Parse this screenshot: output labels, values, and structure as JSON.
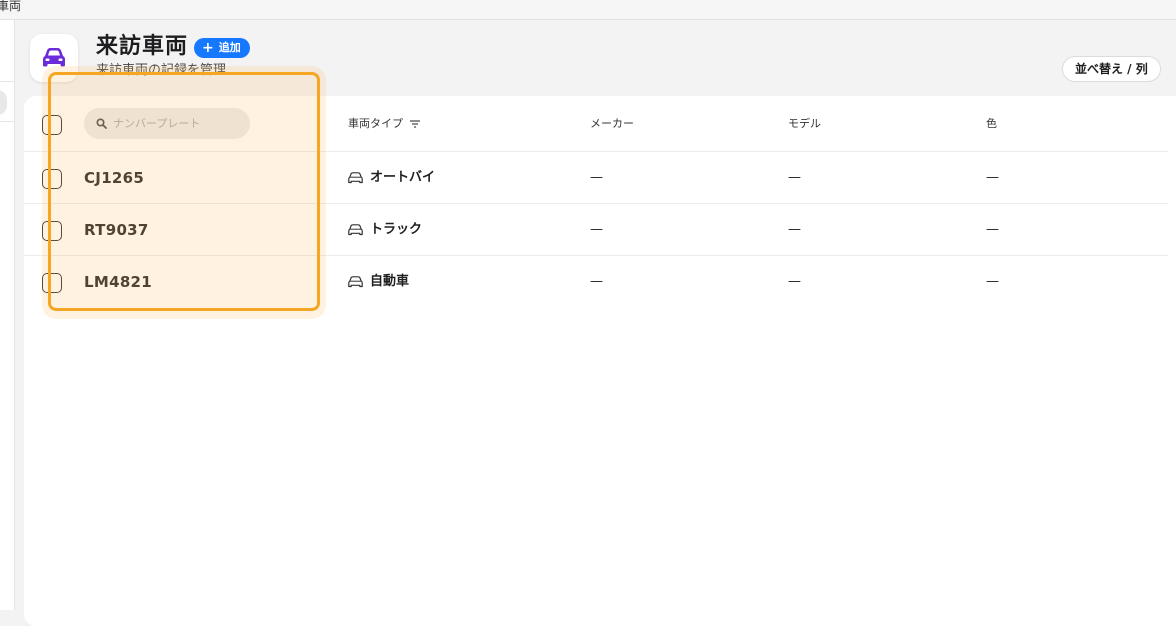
{
  "window": {
    "title": "車両"
  },
  "header": {
    "title": "来訪車両",
    "add_label": "追加",
    "subtitle": "来訪車両の記録を管理",
    "sort_label": "並べ替え / 列"
  },
  "table": {
    "search_placeholder": "ナンバープレート",
    "columns": {
      "type": "車両タイプ",
      "maker": "メーカー",
      "model": "モデル",
      "color": "色"
    },
    "rows": [
      {
        "plate": "CJ1265",
        "type": "オートバイ",
        "maker": "—",
        "model": "—",
        "color": "—"
      },
      {
        "plate": "RT9037",
        "type": "トラック",
        "maker": "—",
        "model": "—",
        "color": "—"
      },
      {
        "plate": "LM4821",
        "type": "自動車",
        "maker": "—",
        "model": "—",
        "color": "—"
      }
    ]
  },
  "colors": {
    "accent": "#1677ff",
    "icon_purple": "#6c2bd9",
    "highlight": "#f5a623"
  },
  "icons": {
    "app": "car-icon",
    "search": "search-icon",
    "filter": "filter-icon",
    "row_type": "car-outline-icon"
  }
}
